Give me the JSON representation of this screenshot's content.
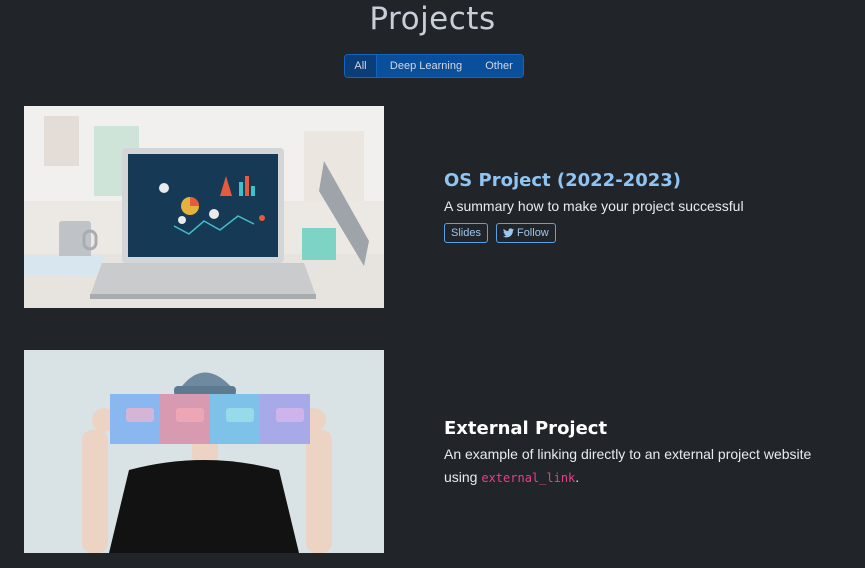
{
  "page": {
    "title": "Projects"
  },
  "filters": [
    "All",
    "Deep Learning",
    "Other"
  ],
  "projects": [
    {
      "title": "OS Project (2022-2023)",
      "summary": "A summary how to make your project successful",
      "buttons": {
        "slides": "Slides",
        "follow": "Follow"
      },
      "icons": {
        "follow": "twitter-icon"
      }
    },
    {
      "title": "External Project",
      "summary_prefix": "An example of linking directly to an external project website using ",
      "summary_code": "external_link",
      "summary_suffix": "."
    }
  ],
  "colors": {
    "background": "#212529",
    "filter_active": "#0b3e79",
    "filter_bg": "#0a4f9c",
    "accent_title": "#90c4f3",
    "code": "#e83e8c"
  }
}
